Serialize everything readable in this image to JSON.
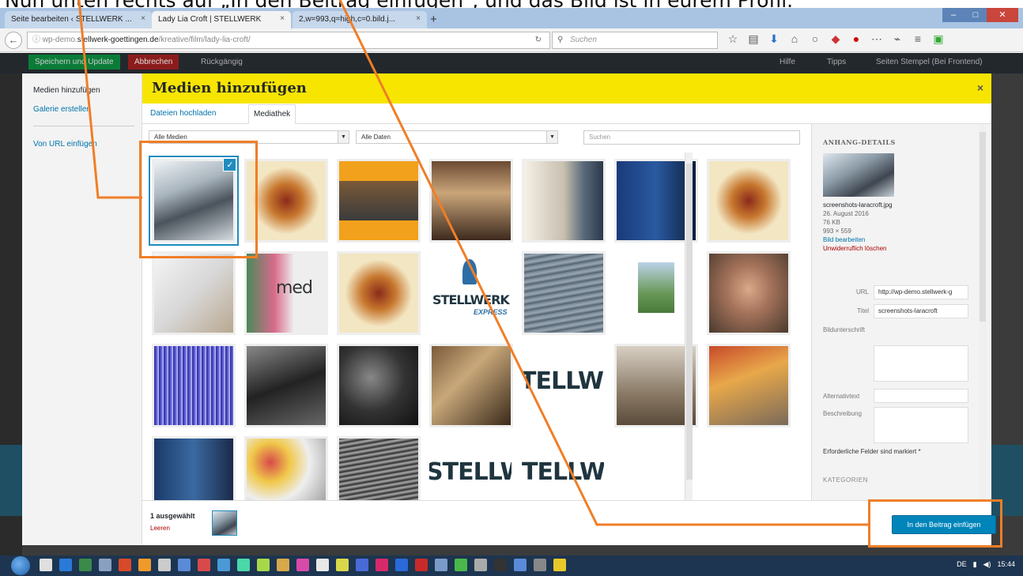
{
  "caption": "Nun unten rechts auf „In den Beitrag einfügen“, und das Bild ist in eurem Profil.",
  "browser": {
    "tabs": [
      {
        "title": "Seite bearbeiten ‹ STELLWERK ..."
      },
      {
        "title": "Lady Lia Croft | STELLWERK"
      },
      {
        "title": "2,w=993,q=high,c=0.bild.j..."
      }
    ],
    "url_prefix": "wp-demo.",
    "url_domain": "stellwerk-goettingen.de",
    "url_path": "/kreative/film/lady-lia-croft/",
    "search_placeholder": "Suchen"
  },
  "adminbar": {
    "save": "Speichern und Update",
    "cancel": "Abbrechen",
    "back": "Rückgängig",
    "help": "Hilfe",
    "tips": "Tipps",
    "exit": "Seiten Stempel (Bei Frontend)"
  },
  "modal": {
    "menu": {
      "add_media": "Medien hinzufügen",
      "create_gallery": "Galerie erstellen",
      "from_url": "Von URL einfügen"
    },
    "title": "Medien hinzufügen",
    "close_symbol": "×",
    "tabs": {
      "upload": "Dateien hochladen",
      "library": "Mediathek"
    },
    "filter_type": "Alle Medien",
    "filter_date": "Alle Daten",
    "search_placeholder": "Suchen",
    "thumbs": [
      {
        "label": ""
      },
      {
        "label": ""
      },
      {
        "label": ""
      },
      {
        "label": ""
      },
      {
        "label": ""
      },
      {
        "label": ""
      },
      {
        "label": ""
      },
      {
        "label": ""
      },
      {
        "label": "med"
      },
      {
        "label": ""
      },
      {
        "label": "STELLWERK"
      },
      {
        "label": ""
      },
      {
        "label": ""
      },
      {
        "label": ""
      },
      {
        "label": ""
      },
      {
        "label": ""
      },
      {
        "label": ""
      },
      {
        "label": ""
      },
      {
        "label": "TELLWI"
      },
      {
        "label": ""
      },
      {
        "label": ""
      },
      {
        "label": ""
      },
      {
        "label": ""
      },
      {
        "label": ""
      },
      {
        "label": "STELLW"
      },
      {
        "label": "TELLW"
      }
    ],
    "details": {
      "heading": "ANHANG-DETAILS",
      "filename": "screenshots-laracroft.jpg",
      "date": "26. August 2016",
      "size": "76 KB",
      "dimensions": "993 × 559",
      "edit": "Bild bearbeiten",
      "delete": "Unwiderruflich löschen",
      "url_label": "URL",
      "url_value": "http://wp-demo.stellwerk-g",
      "title_label": "Titel",
      "title_value": "screenshots-laracroft",
      "caption_label": "Bildunterschrift",
      "alt_label": "Alternativtext",
      "desc_label": "Beschreibung",
      "required_note": "Erforderliche Felder sind markiert *",
      "categories": "KATEGORIEN"
    },
    "footer": {
      "selected": "1 ausgewählt",
      "clear": "Leeren",
      "insert": "In den Beitrag einfügen"
    }
  },
  "taskbar": {
    "lang": "DE",
    "time": "15:44"
  }
}
